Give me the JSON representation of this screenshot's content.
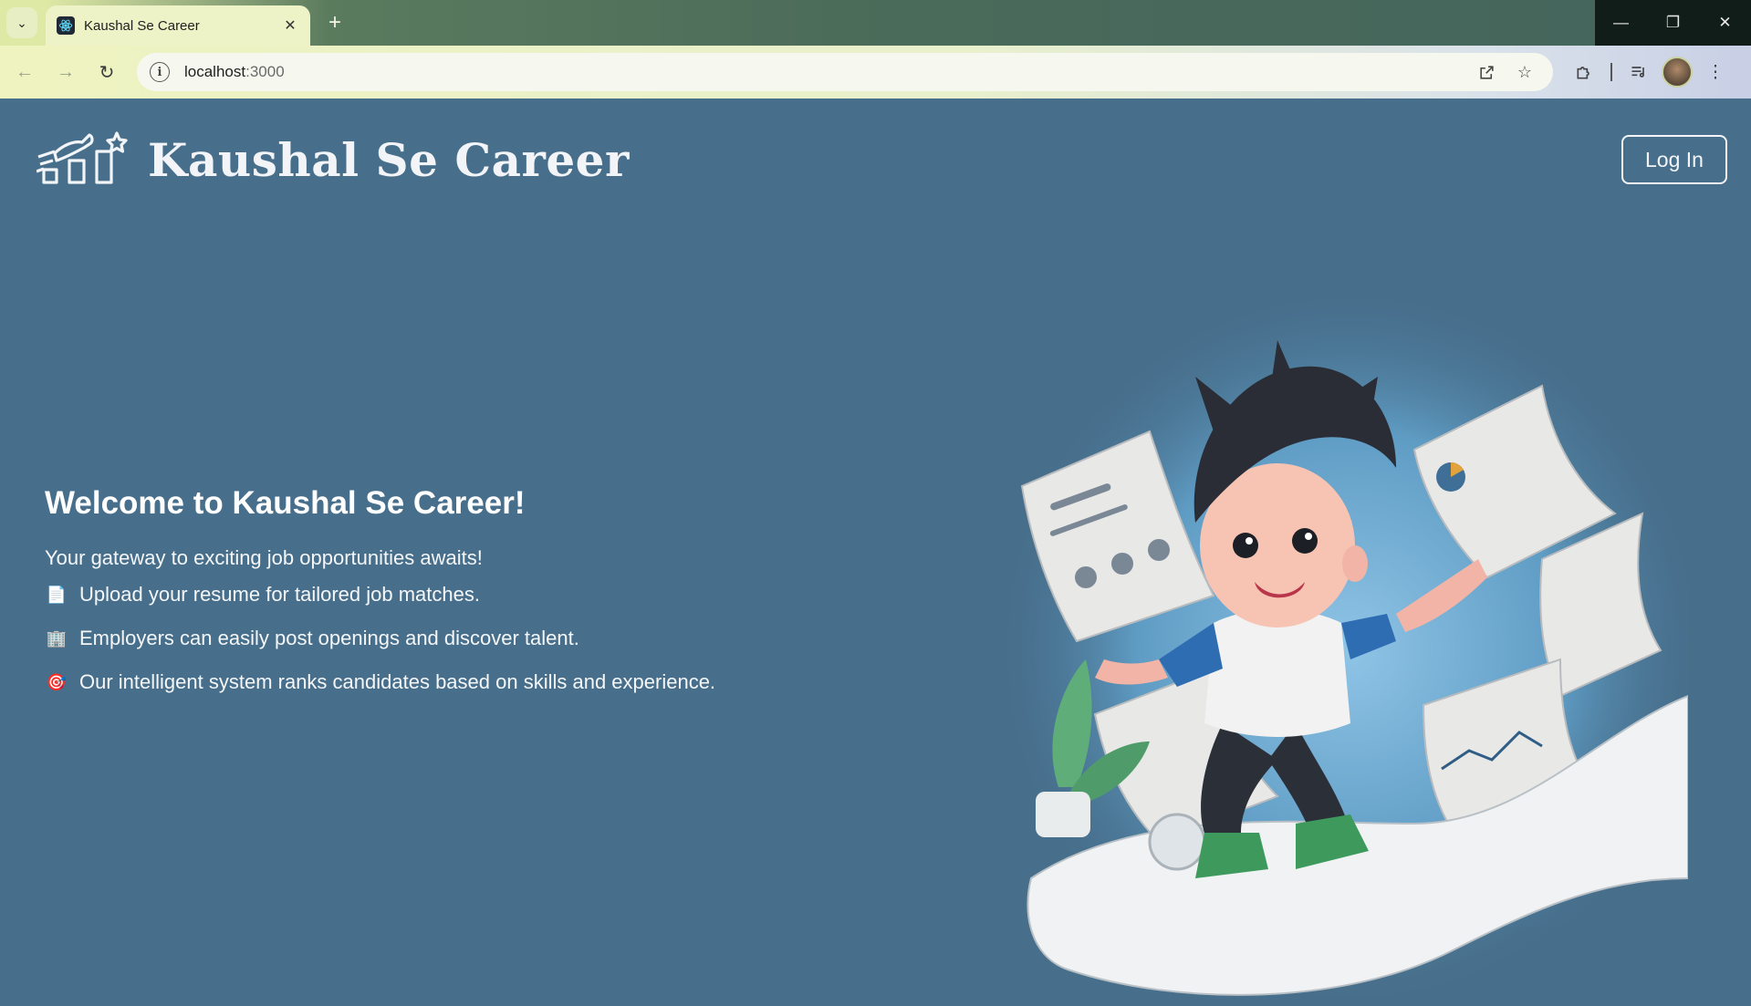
{
  "browser": {
    "tab_title": "Kaushal Se Career",
    "url_host": "localhost",
    "url_port": ":3000",
    "icons": {
      "tab_search": "chevron-down-icon",
      "tab_favicon": "react-icon",
      "tab_close": "close-icon",
      "new_tab": "plus-icon",
      "back": "arrow-left-icon",
      "forward": "arrow-right-icon",
      "reload": "reload-icon",
      "site_info": "info-icon",
      "open_in_app": "open-external-icon",
      "bookmark": "star-icon",
      "extensions": "puzzle-icon",
      "media": "media-queue-icon",
      "menu": "kebab-menu-icon",
      "minimize": "minimize-icon",
      "restore": "restore-icon",
      "close_window": "close-icon"
    }
  },
  "header": {
    "brand": "Kaushal Se Career",
    "login_label": "Log In"
  },
  "hero": {
    "title": "Welcome to Kaushal Se Career!",
    "subtitle": "Your gateway to exciting job opportunities awaits!",
    "features": [
      {
        "emoji": "📄",
        "text": "Upload your resume for tailored job matches."
      },
      {
        "emoji": "🏢",
        "text": "Employers can easily post openings and discover talent."
      },
      {
        "emoji": "🎯",
        "text": "Our intelligent system ranks candidates based on skills and experience."
      }
    ]
  },
  "colors": {
    "page_background": "#476f8c",
    "text": "#ffffff"
  }
}
